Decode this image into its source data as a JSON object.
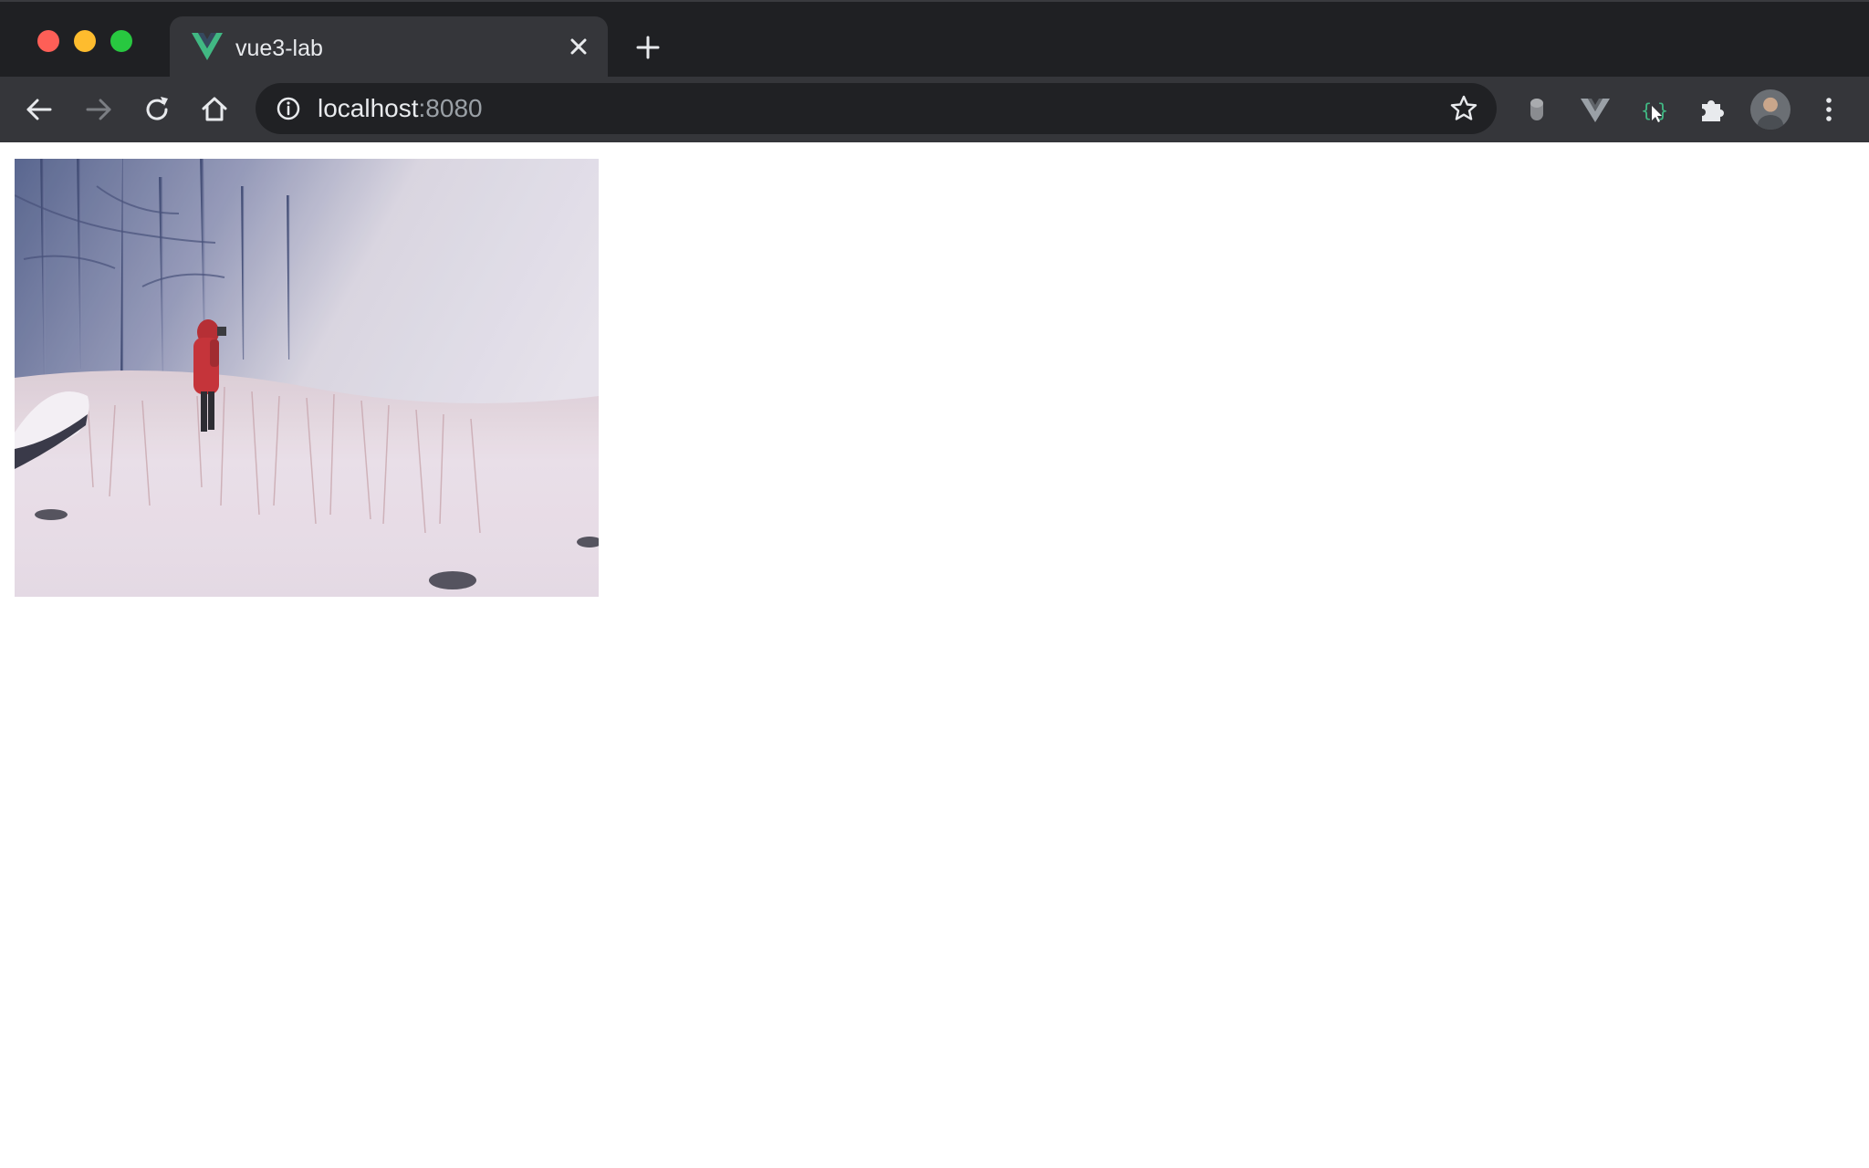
{
  "window": {
    "controls": [
      "close",
      "minimize",
      "maximize"
    ]
  },
  "tab": {
    "title": "vue3-lab",
    "favicon": "vue-logo-icon",
    "favicon_color": "#41b883"
  },
  "toolbar": {
    "url_host": "localhost",
    "url_port": ":8080",
    "icons": [
      "back-icon",
      "forward-icon",
      "reload-icon",
      "home-icon",
      "info-icon",
      "star-icon",
      "extension-icon",
      "vue-devtools-icon",
      "inspector-icon",
      "puzzle-icon",
      "menu-icon"
    ]
  },
  "content": {
    "image": "photo of person in red coat standing in snowy field"
  },
  "colors": {
    "tabstrip": "#1f2023",
    "toolbar": "#35363a",
    "omnibox": "#202124",
    "text": "#e8eaed",
    "muted": "#9aa0a6"
  }
}
